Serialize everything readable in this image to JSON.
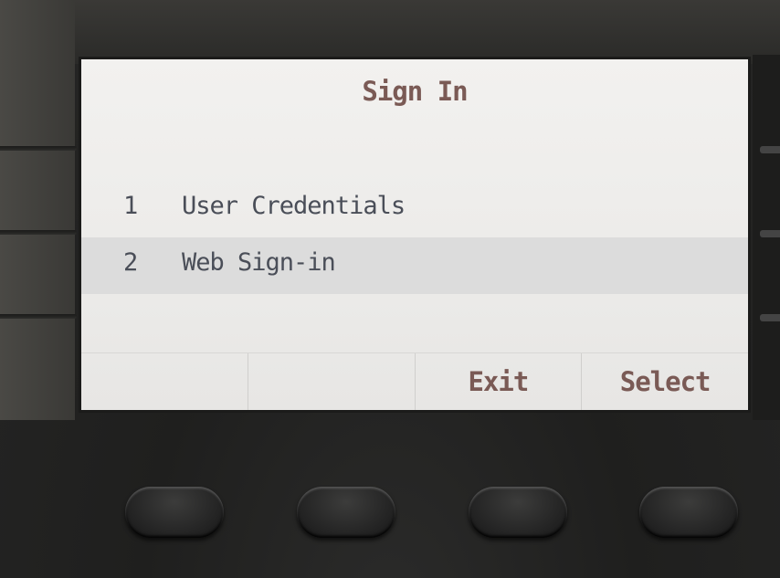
{
  "screen": {
    "title": "Sign In",
    "menu": [
      {
        "number": "1",
        "label": "User Credentials",
        "selected": false
      },
      {
        "number": "2",
        "label": "Web Sign-in",
        "selected": true
      }
    ],
    "softkeys": [
      "",
      "",
      "Exit",
      "Select"
    ]
  },
  "colors": {
    "title_color": "#7a5a55",
    "item_color": "#4a4e58",
    "selected_bg": "#dcdcdc"
  }
}
